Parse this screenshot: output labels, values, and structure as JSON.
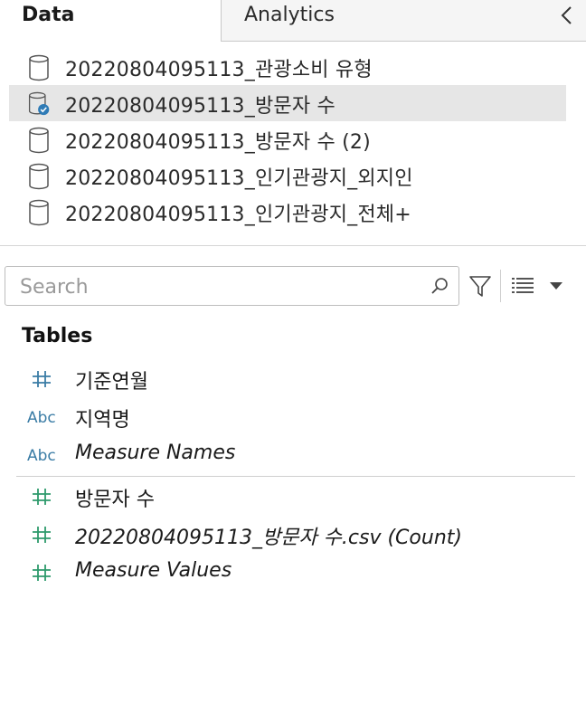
{
  "tabs": {
    "data": "Data",
    "analytics": "Analytics"
  },
  "sources": [
    {
      "label": "20220804095113_관광소비 유형",
      "selected": false
    },
    {
      "label": "20220804095113_방문자 수",
      "selected": true
    },
    {
      "label": "20220804095113_방문자 수 (2)",
      "selected": false
    },
    {
      "label": "20220804095113_인기관광지_외지인",
      "selected": false
    },
    {
      "label": "20220804095113_인기관광지_전체+",
      "selected": false
    }
  ],
  "search": {
    "placeholder": "Search",
    "value": ""
  },
  "tables": {
    "heading": "Tables",
    "dimensions": [
      {
        "type": "number",
        "label": "기준연월",
        "italic": false
      },
      {
        "type": "string",
        "type_label": "Abc",
        "label": "지역명",
        "italic": false
      },
      {
        "type": "string",
        "type_label": "Abc",
        "label": "Measure Names",
        "italic": true
      }
    ],
    "measures": [
      {
        "type": "number",
        "label": "방문자 수",
        "italic": false
      },
      {
        "type": "number",
        "label": "20220804095113_방문자 수.csv (Count)",
        "italic": true
      },
      {
        "type": "number",
        "label": "Measure Values",
        "italic": true
      }
    ]
  },
  "colors": {
    "dimension": "#3a7ca5",
    "measure": "#2e9a6b",
    "selected_bg": "#e6e6e6",
    "check_badge": "#2f7bb6"
  }
}
